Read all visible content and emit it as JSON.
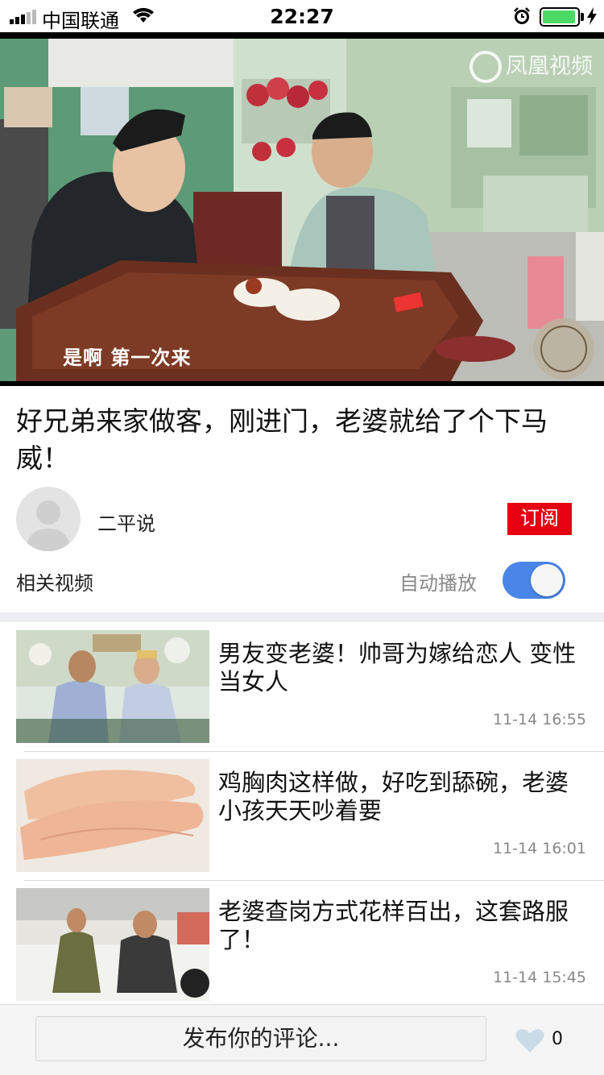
{
  "status_bar": {
    "carrier": "中国联通",
    "time": "22:27",
    "battery_level": 0.95
  },
  "video": {
    "watermark": "凤凰视频",
    "subtitle": "是啊 第一次来",
    "progress": 0.05
  },
  "article": {
    "title": "好兄弟来家做客，刚进门，老婆就给了个下马威！",
    "author": "二平说",
    "subscribe_label": "订阅",
    "related_label": "相关视频",
    "autoplay_label": "自动播放",
    "autoplay_on": true
  },
  "related_videos": [
    {
      "title": "男友变老婆！帅哥为嫁给恋人 变性当女人",
      "time": "11-14 16:55"
    },
    {
      "title": "鸡胸肉这样做，好吃到舔碗，老婆小孩天天吵着要",
      "time": "11-14 16:01"
    },
    {
      "title": "老婆查岗方式花样百出，这套路服了！",
      "time": "11-14 15:45"
    }
  ],
  "bottom_bar": {
    "comment_label": "发布你的评论...",
    "like_count": "0"
  },
  "colors": {
    "subscribe": "#e60012",
    "toggle": "#4a86e8",
    "battery": "#4cd964"
  }
}
